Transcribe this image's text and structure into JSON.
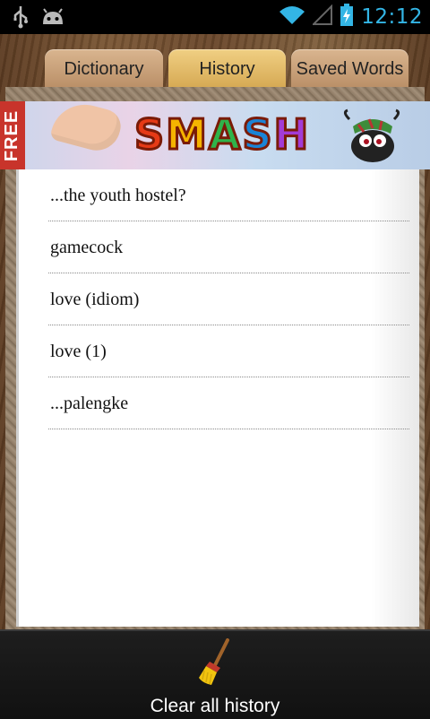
{
  "status_bar": {
    "time": "12:12",
    "icons": [
      "usb-icon",
      "android-icon",
      "wifi-icon",
      "signal-icon",
      "battery-charging-icon"
    ]
  },
  "tabs": [
    {
      "label": "Dictionary",
      "active": false
    },
    {
      "label": "History",
      "active": true
    },
    {
      "label": "Saved Words",
      "active": false
    }
  ],
  "banner": {
    "free_label": "FREE",
    "brand_letters": [
      "S",
      "M",
      "A",
      "S",
      "H"
    ]
  },
  "history": {
    "items": [
      "...the youth hostel?",
      "gamecock",
      "love (idiom)",
      "love (1)",
      "...palengke"
    ]
  },
  "bottom_bar": {
    "clear_label": "Clear all history",
    "icon": "broom-icon"
  },
  "colors": {
    "status_accent": "#33b5e5",
    "active_tab": "#e8c16e",
    "inactive_tab": "#c9a07a",
    "bottom_bar": "#1a1a1a"
  }
}
